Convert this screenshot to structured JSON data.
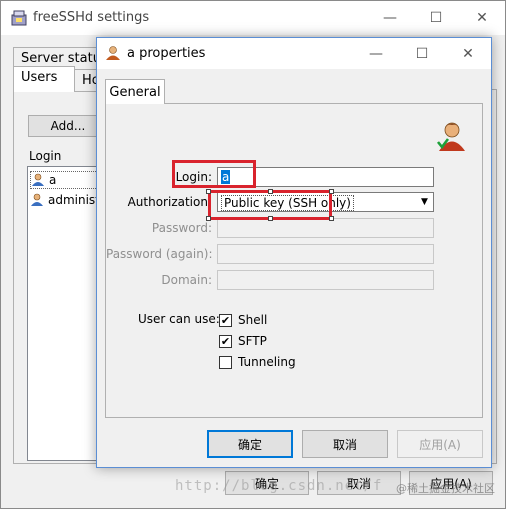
{
  "back_window": {
    "title": "freeSSHd settings",
    "tabs": [
      "Server status",
      "Users",
      "Ho"
    ],
    "add_button": "Add...",
    "login_header": "Login",
    "users": [
      "a",
      "administra"
    ],
    "buttons": {
      "ok": "确定",
      "cancel": "取消",
      "apply": "应用(A)"
    }
  },
  "dialog": {
    "title": "a properties",
    "tab": "General",
    "fields": {
      "login_label": "Login:",
      "login_value": "a",
      "authorization_label": "Authorization:",
      "authorization_value": "Public key (SSH only)",
      "password_label": "Password:",
      "password_again_label": "Password (again):",
      "domain_label": "Domain:"
    },
    "user_can_use_label": "User can use:",
    "options": [
      {
        "label": "Shell",
        "checked": true
      },
      {
        "label": "SFTP",
        "checked": true
      },
      {
        "label": "Tunneling",
        "checked": false
      }
    ],
    "buttons": {
      "ok": "确定",
      "cancel": "取消",
      "apply": "应用(A)"
    }
  },
  "caption": {
    "minimize": "—",
    "maximize": "☐",
    "close": "✕"
  },
  "watermark": "http://blog.csdn.net/f",
  "watermark_brand": "@稀土掘金技术社区",
  "colors": {
    "highlight": "#d9232d",
    "selection": "#0078d7"
  }
}
